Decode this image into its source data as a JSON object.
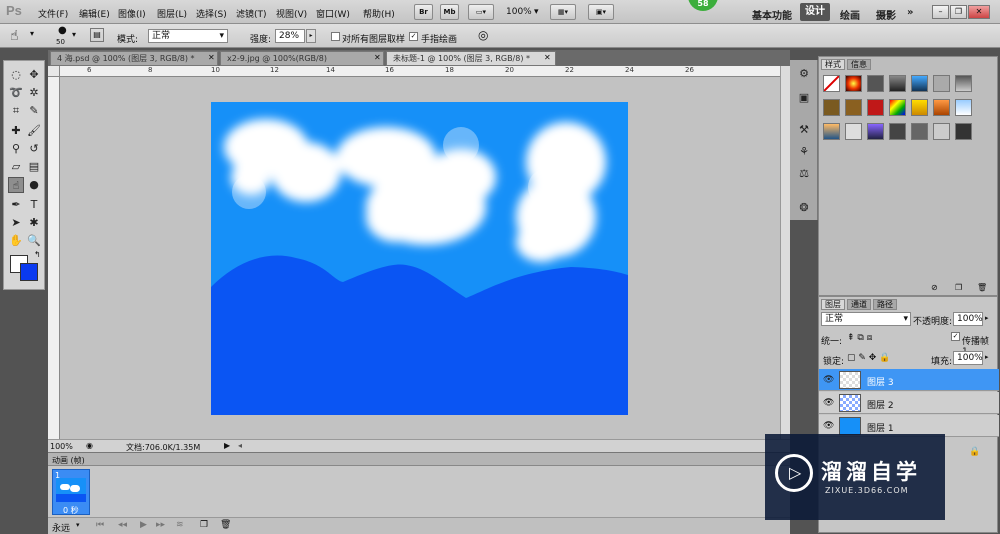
{
  "menubar": {
    "logo": "Ps",
    "items": [
      "文件(F)",
      "编辑(E)",
      "图像(I)",
      "图层(L)",
      "选择(S)",
      "滤镜(T)",
      "视图(V)",
      "窗口(W)",
      "帮助(H)"
    ],
    "buttons": [
      "Br",
      "Mb"
    ],
    "zoom": "100%",
    "badge": "58",
    "workspaces": [
      "基本功能",
      "设计",
      "绘画",
      "摄影"
    ],
    "active_workspace": "设计",
    "more": "»"
  },
  "options": {
    "brush_size": "50",
    "mode_label": "模式:",
    "mode_value": "正常",
    "strength_label": "强度:",
    "strength_value": "28%",
    "sample_all_label": "对所有图层取样",
    "finger_paint_label": "手指绘画"
  },
  "tabs": [
    "4 海.psd @ 100% (图层 3, RGB/8) *",
    "x2-9.jpg @ 100%(RGB/8)",
    "未标题-1 @ 100% (图层 3, RGB/8) *"
  ],
  "ruler_h": [
    "6",
    "8",
    "10",
    "12",
    "14",
    "16",
    "18",
    "20",
    "22",
    "24",
    "26"
  ],
  "status": {
    "zoom": "100%",
    "doc": "文档:706.0K/1.35M"
  },
  "animation": {
    "title": "动画 (帧)",
    "frame_num": "1",
    "frame_time": "0 秒",
    "loop": "永远"
  },
  "styles_panel": {
    "tabs": [
      "样式",
      "信息"
    ]
  },
  "layers_panel": {
    "tabs": [
      "图层",
      "通道",
      "路径"
    ],
    "blend_mode": "正常",
    "opacity_label": "不透明度:",
    "opacity_value": "100%",
    "unify_label": "统一:",
    "propagate_label": "传播帧 1",
    "lock_label": "锁定:",
    "fill_label": "填充:",
    "fill_value": "100%",
    "layers": [
      {
        "name": "图层 3",
        "selected": true
      },
      {
        "name": "图层 2",
        "selected": false
      },
      {
        "name": "图层 1",
        "selected": false
      }
    ]
  },
  "watermark": {
    "cn": "溜溜自学",
    "url": "ZIXUE.3D66.COM"
  }
}
